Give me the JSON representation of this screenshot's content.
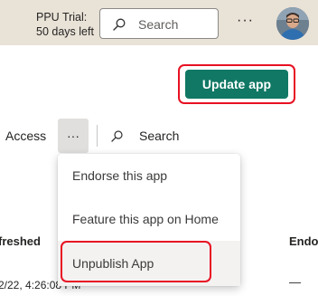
{
  "topbar": {
    "trial_line1": "PPU Trial:",
    "trial_line2": "50 days left",
    "search_placeholder": "Search",
    "more_label": "···"
  },
  "actions": {
    "update_app_label": "Update app"
  },
  "commandbar": {
    "access_label": "Access",
    "more_label": "···",
    "search_label": "Search"
  },
  "table": {
    "col_refreshed": "freshed",
    "col_endorse": "Endo",
    "row_date": "2/22, 4:26:08 PM",
    "row_endorse": "—"
  },
  "menu": {
    "items": [
      {
        "label": "Endorse this app"
      },
      {
        "label": "Feature this app on Home"
      },
      {
        "label": "Unpublish App"
      }
    ]
  },
  "colors": {
    "accent_green": "#117865",
    "highlight_red": "#e81123",
    "topbar_bg": "#e9e2d7"
  }
}
